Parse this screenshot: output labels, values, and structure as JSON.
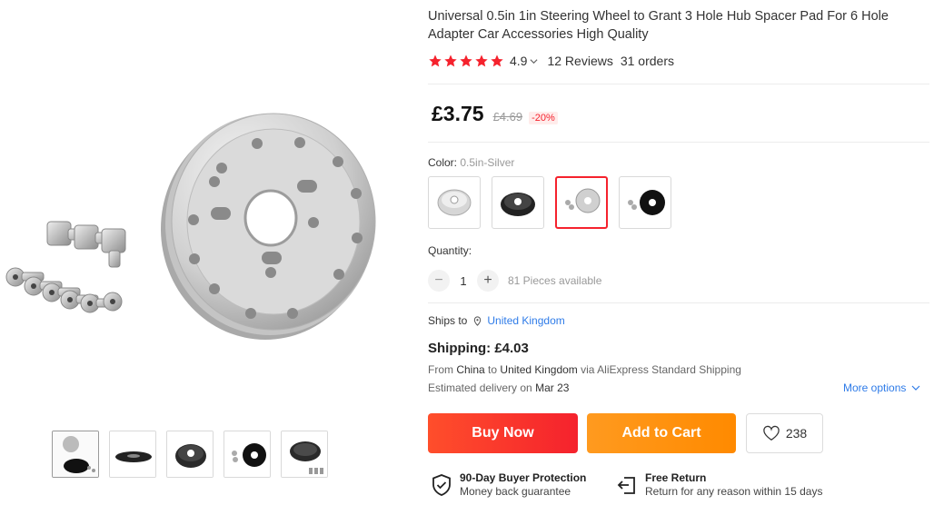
{
  "product": {
    "title": "Universal 0.5in 1in Steering Wheel to Grant 3 Hole Hub Spacer Pad For 6 Hole Adapter Car Accessories High Quality",
    "rating": "4.9",
    "stars": 5,
    "reviews": "12 Reviews",
    "orders": "31 orders"
  },
  "price": {
    "current": "£3.75",
    "original": "£4.69",
    "discount": "-20%"
  },
  "color": {
    "label": "Color:",
    "selected": "0.5in-Silver",
    "selected_index": 2
  },
  "quantity": {
    "label": "Quantity:",
    "value": "1",
    "minus": "−",
    "plus": "+",
    "available": "81 Pieces available"
  },
  "shipping": {
    "ships_to_label": "Ships to",
    "ships_to_country": "United Kingdom",
    "label": "Shipping:",
    "cost": "£4.03",
    "from_word": "From",
    "from_country": "China",
    "to_word": "to",
    "to_country": "United Kingdom",
    "via": "via AliExpress Standard Shipping",
    "delivery_label": "Estimated delivery on",
    "delivery_date": "Mar 23",
    "more_options": "More options"
  },
  "actions": {
    "buy_now": "Buy Now",
    "add_to_cart": "Add to Cart",
    "wishlist_count": "238"
  },
  "guarantees": {
    "protection_title": "90-Day Buyer Protection",
    "protection_sub": "Money back guarantee",
    "return_title": "Free Return",
    "return_sub": "Return for any reason within 15 days"
  },
  "colors": {
    "star": "#f5222d",
    "link": "#2e7be8",
    "buy_now": "#f5222d",
    "add_to_cart": "#ff8a00"
  },
  "icons": {
    "star": "star-icon",
    "pin": "location-pin-icon",
    "heart": "heart-icon",
    "shield": "shield-check-icon",
    "return": "return-icon"
  }
}
